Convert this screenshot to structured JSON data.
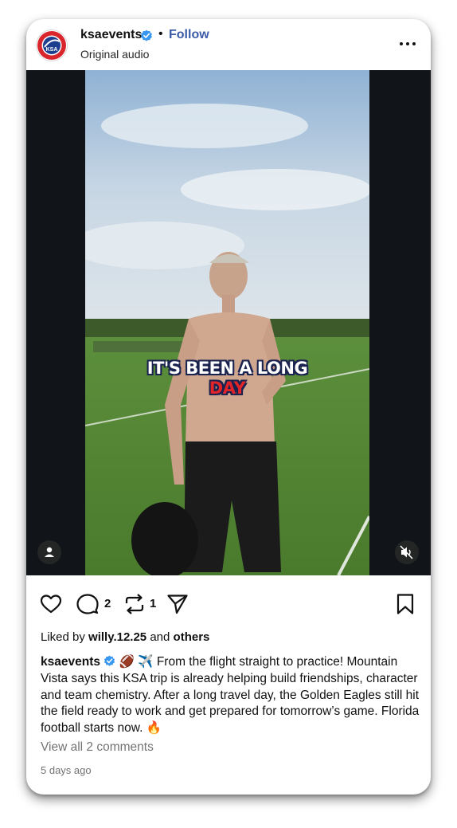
{
  "post": {
    "username": "ksaevents",
    "separator": "•",
    "follow_label": "Follow",
    "subtitle": "Original audio",
    "avatar_text": "KSA",
    "video_caption_line1": "IT'S BEEN A LONG",
    "video_caption_line2": "DAY",
    "comment_count": "2",
    "repost_count": "1",
    "liked_prefix": "Liked by",
    "liked_user": "willy.12.25",
    "liked_and": "and",
    "liked_others": "others",
    "caption_username": "ksaevents",
    "caption_text": "🏈 ✈️ From the flight straight to practice! Mountain Vista says this KSA trip is already helping build friendships, character and team chemistry. After a long travel day, the Golden Eagles still hit the field ready to work and get prepared for tomorrow’s game. Florida football starts now. 🔥",
    "view_comments": "View all 2 comments",
    "timestamp": "5 days ago"
  },
  "icons": {
    "verified": "verified-badge-icon",
    "more": "more-options-icon",
    "like": "heart-icon",
    "comment": "comment-icon",
    "repost": "repost-icon",
    "share": "share-icon",
    "save": "bookmark-icon",
    "user_tag": "person-icon",
    "mute": "speaker-muted-icon"
  },
  "colors": {
    "follow": "#3b5aa8",
    "verified": "#3897f0",
    "caption_red": "#e12428",
    "muted_text": "#737373"
  }
}
